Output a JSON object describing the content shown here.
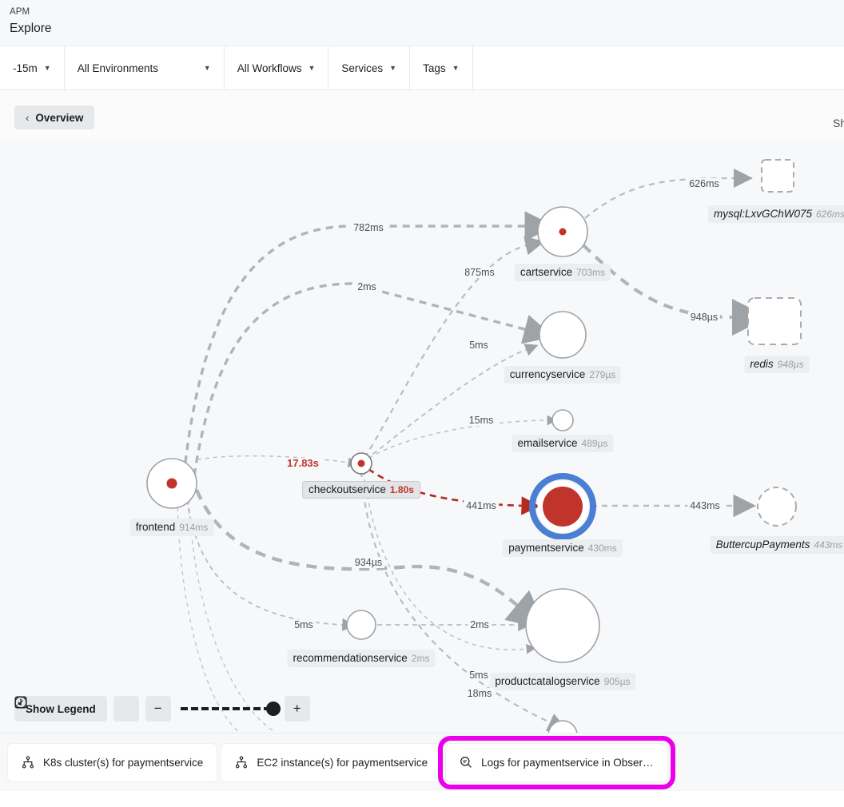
{
  "header": {
    "product": "APM",
    "page": "Explore"
  },
  "filters": [
    {
      "label": "-15m",
      "caret": "▼",
      "wide": false
    },
    {
      "label": "All Environments",
      "caret": "▼",
      "wide": true
    },
    {
      "label": "All Workflows",
      "caret": "▼",
      "wide": false
    },
    {
      "label": "Services",
      "caret": "▼",
      "wide": false
    },
    {
      "label": "Tags",
      "caret": "▼",
      "wide": false
    }
  ],
  "overview": {
    "back_chevron": "‹",
    "label": "Overview",
    "right_clipped": "Sh"
  },
  "graph": {
    "nodes": [
      {
        "id": "frontend",
        "name": "frontend",
        "duration": "914ms",
        "style": "service",
        "kind": "internal"
      },
      {
        "id": "checkoutservice",
        "name": "checkoutservice",
        "duration": "1.80s",
        "style": "selected-label",
        "kind": "internal"
      },
      {
        "id": "cartservice",
        "name": "cartservice",
        "duration": "703ms",
        "style": "service",
        "kind": "internal"
      },
      {
        "id": "currencyservice",
        "name": "currencyservice",
        "duration": "279µs",
        "style": "plain",
        "kind": "internal"
      },
      {
        "id": "emailservice",
        "name": "emailservice",
        "duration": "489µs",
        "style": "plain",
        "kind": "internal"
      },
      {
        "id": "paymentservice",
        "name": "paymentservice",
        "duration": "430ms",
        "style": "highlighted",
        "kind": "internal"
      },
      {
        "id": "recommendationservice",
        "name": "recommendationservice",
        "duration": "2ms",
        "style": "plain",
        "kind": "internal"
      },
      {
        "id": "productcatalogservice",
        "name": "productcatalogservice",
        "duration": "905µs",
        "style": "plain",
        "kind": "internal"
      },
      {
        "id": "mysql",
        "name": "mysql:LxvGChW075",
        "duration": "626ms",
        "style": "external-db",
        "kind": "external"
      },
      {
        "id": "redis",
        "name": "redis",
        "duration": "948µs",
        "style": "external-db",
        "kind": "external"
      },
      {
        "id": "buttercuppayments",
        "name": "ButtercupPayments",
        "duration": "443ms",
        "style": "external-web",
        "kind": "external"
      }
    ],
    "edges": [
      {
        "from": "frontend",
        "to": "cartservice",
        "label": "782ms",
        "error": false
      },
      {
        "from": "frontend",
        "to": "currencyservice",
        "label": "2ms",
        "error": false
      },
      {
        "from": "checkoutservice",
        "to": "cartservice",
        "label": "875ms",
        "error": false
      },
      {
        "from": "checkoutservice",
        "to": "currencyservice",
        "label": "5ms",
        "error": false
      },
      {
        "from": "checkoutservice",
        "to": "emailservice",
        "label": "15ms",
        "error": false
      },
      {
        "from": "frontend",
        "to": "checkoutservice",
        "label": "17.83s",
        "error": true
      },
      {
        "from": "checkoutservice",
        "to": "paymentservice",
        "label": "441ms",
        "error": true
      },
      {
        "from": "frontend",
        "to": "productcatalogservice",
        "label": "934µs",
        "error": false
      },
      {
        "from": "frontend",
        "to": "recommendationservice",
        "label": "5ms",
        "error": false
      },
      {
        "from": "recommendationservice",
        "to": "productcatalogservice",
        "label": "2ms",
        "error": false
      },
      {
        "from": "checkoutservice",
        "to": "productcatalogservice",
        "label": "5ms",
        "error": false
      },
      {
        "from": "checkoutservice",
        "to": "shippingservice",
        "label": "18ms",
        "error": false
      },
      {
        "from": "cartservice",
        "to": "mysql",
        "label": "626ms",
        "error": false
      },
      {
        "from": "cartservice",
        "to": "redis",
        "label": "948µs",
        "error": false
      },
      {
        "from": "paymentservice",
        "to": "buttercuppayments",
        "label": "443ms",
        "error": false
      }
    ]
  },
  "controls": {
    "legend_label": "Show Legend",
    "info_icon": "info-icon",
    "fit_icon": "fit-to-screen-icon",
    "zoom_out": "−",
    "zoom_in": "+"
  },
  "actions": [
    {
      "label": "K8s cluster(s) for paymentservice",
      "icon": "hierarchy-icon",
      "highlighted": false
    },
    {
      "label": "EC2 instance(s) for paymentservice",
      "icon": "hierarchy-icon",
      "highlighted": false
    },
    {
      "label": "Logs for paymentservice in Obser…",
      "icon": "log-search-icon",
      "highlighted": true
    }
  ],
  "colors": {
    "error_red": "#c0342b",
    "selection_blue": "#4a7fd4",
    "highlight_magenta": "#ea00ea",
    "edge_gray": "#b0b4b8",
    "canvas_bg": "#f7f8f9"
  }
}
